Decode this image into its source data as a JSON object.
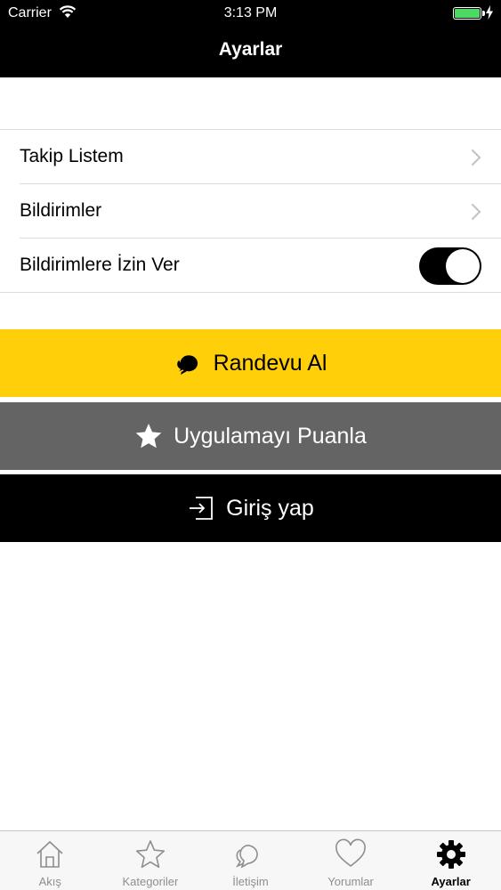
{
  "status_bar": {
    "carrier": "Carrier",
    "time": "3:13 PM",
    "battery_color": "#4cd964"
  },
  "nav": {
    "title": "Ayarlar"
  },
  "settings": {
    "items": [
      {
        "label": "Takip Listem",
        "accessory": "chevron-right-icon"
      },
      {
        "label": "Bildirimler",
        "accessory": "chevron-right-icon"
      },
      {
        "label": "Bildirimlere İzin Ver",
        "accessory": "toggle",
        "toggle_on": true
      }
    ]
  },
  "actions": {
    "appointment": {
      "label": "Randevu Al",
      "icon": "chat-bubbles-icon",
      "color": "#ffcf0a"
    },
    "rate": {
      "label": "Uygulamayı Puanla",
      "icon": "star-icon",
      "color": "#646464"
    },
    "login": {
      "label": "Giriş yap",
      "icon": "sign-in-icon",
      "color": "#000000"
    }
  },
  "tabbar": {
    "active": "Ayarlar",
    "tabs": [
      {
        "label": "Akış",
        "icon": "home-icon"
      },
      {
        "label": "Kategoriler",
        "icon": "star-icon"
      },
      {
        "label": "İletişim",
        "icon": "chat-bubbles-icon"
      },
      {
        "label": "Yorumlar",
        "icon": "heart-icon"
      },
      {
        "label": "Ayarlar",
        "icon": "gear-icon"
      }
    ]
  }
}
